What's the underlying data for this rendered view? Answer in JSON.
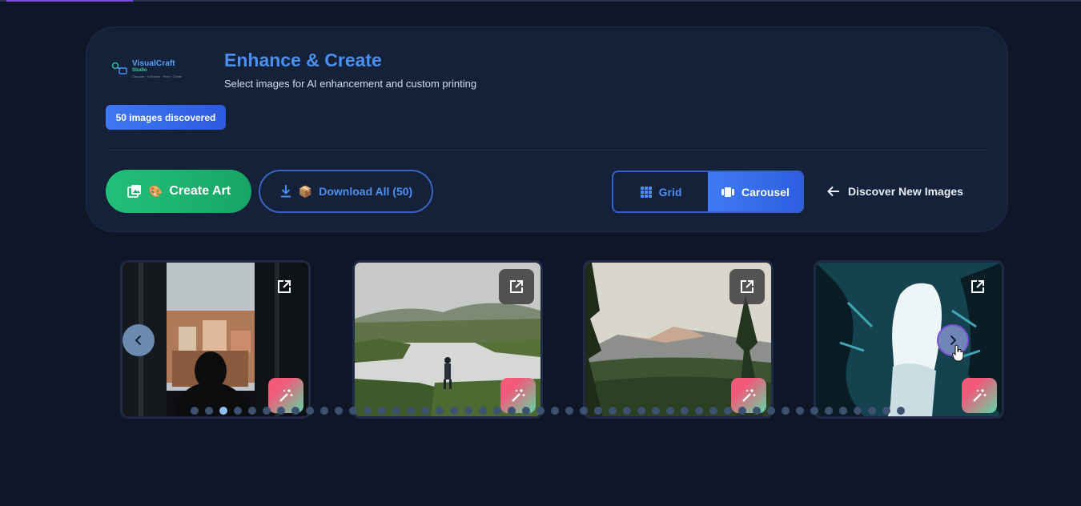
{
  "header": {
    "logo": {
      "brand": "VisualCraft",
      "brand2": "Studio",
      "tagline": "Discover · Enhance · Print · Create"
    },
    "title": "Enhance & Create",
    "subtitle": "Select images for AI enhancement and custom printing",
    "badge": "50 images discovered"
  },
  "actions": {
    "create_art": {
      "label": "Create Art",
      "icon": "images-icon",
      "emoji": "🎨"
    },
    "download_all": {
      "label": "Download All (50)",
      "icon": "download-icon",
      "emoji": "📦"
    }
  },
  "view_toggle": {
    "grid": {
      "label": "Grid",
      "icon": "grid-icon"
    },
    "carousel": {
      "label": "Carousel",
      "icon": "carousel-icon"
    },
    "selected": "carousel"
  },
  "discover": {
    "label": "Discover New Images",
    "icon": "arrow-left-icon"
  },
  "carousel": {
    "cards": [
      {
        "scene": "silhouette-window-town",
        "open_icon": "external-link-icon",
        "enhance_icon": "magic-wand-icon"
      },
      {
        "scene": "mountain-lake-hiker",
        "open_icon": "external-link-icon",
        "enhance_icon": "magic-wand-icon"
      },
      {
        "scene": "mountain-forest-valley",
        "open_icon": "external-link-icon",
        "enhance_icon": "magic-wand-icon"
      },
      {
        "scene": "ice-cave",
        "open_icon": "external-link-icon",
        "enhance_icon": "magic-wand-icon"
      }
    ],
    "prev_icon": "chevron-left-icon",
    "next_icon": "chevron-right-icon",
    "dot_count": 50,
    "active_dot": 3
  },
  "colors": {
    "background": "#0f1628",
    "panel": "#152039",
    "accent_blue": "#3f7bf2",
    "accent_green": "#22c07a",
    "title_blue": "#4a90f0"
  }
}
